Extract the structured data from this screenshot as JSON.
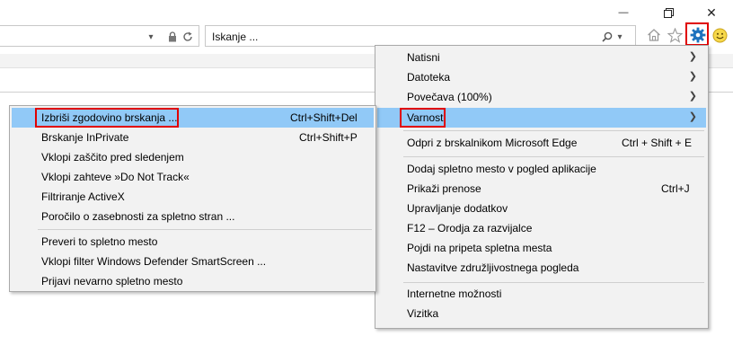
{
  "window": {
    "minimize_label": "—",
    "restore_icon": "restore-icon",
    "close_label": "✕"
  },
  "address": {
    "dropdown_glyph": "▾",
    "lock_icon": "lock-icon",
    "refresh_icon": "refresh-icon"
  },
  "search": {
    "placeholder": "Iskanje ...",
    "search_icon": "search-icon",
    "dropdown_glyph": "▾"
  },
  "toolbar": {
    "home_icon": "home-icon",
    "favorites_icon": "star-icon",
    "tools_icon": "gear-icon",
    "feedback_icon": "smiley-icon"
  },
  "colors": {
    "highlight": "#91c9f7",
    "callout": "#e00000",
    "menu_bg": "#f2f2f2",
    "gear": "#1e73be"
  },
  "tools_menu": {
    "items": [
      {
        "label": "Natisni",
        "shortcut": "",
        "submenu": true
      },
      {
        "label": "Datoteka",
        "shortcut": "",
        "submenu": true
      },
      {
        "label": "Povečava (100%)",
        "shortcut": "",
        "submenu": true
      },
      {
        "label": "Varnost",
        "shortcut": "",
        "submenu": true,
        "highlighted": true
      },
      {
        "label": "Odpri z brskalnikom Microsoft Edge",
        "shortcut": "Ctrl + Shift + E"
      },
      {
        "label": "Dodaj spletno mesto v pogled aplikacije",
        "shortcut": ""
      },
      {
        "label": "Prikaži prenose",
        "shortcut": "Ctrl+J"
      },
      {
        "label": "Upravljanje dodatkov",
        "shortcut": ""
      },
      {
        "label": "F12 – Orodja za razvijalce",
        "shortcut": ""
      },
      {
        "label": "Pojdi na pripeta spletna mesta",
        "shortcut": ""
      },
      {
        "label": "Nastavitve združljivostnega pogleda",
        "shortcut": ""
      },
      {
        "label": "Internetne možnosti",
        "shortcut": ""
      },
      {
        "label": "Vizitka",
        "shortcut": ""
      }
    ]
  },
  "safety_menu": {
    "items": [
      {
        "label": "Izbriši zgodovino brskanja ...",
        "shortcut": "Ctrl+Shift+Del",
        "highlighted": true
      },
      {
        "label": "Brskanje InPrivate",
        "shortcut": "Ctrl+Shift+P"
      },
      {
        "label": "Vklopi zaščito pred sledenjem",
        "shortcut": ""
      },
      {
        "label": "Vklopi zahteve »Do Not Track«",
        "shortcut": ""
      },
      {
        "label": "Filtriranje ActiveX",
        "shortcut": ""
      },
      {
        "label": "Poročilo o zasebnosti za spletno stran ...",
        "shortcut": ""
      },
      {
        "label": "Preveri to spletno mesto",
        "shortcut": ""
      },
      {
        "label": "Vklopi filter Windows Defender SmartScreen ...",
        "shortcut": ""
      },
      {
        "label": "Prijavi nevarno spletno mesto",
        "shortcut": ""
      }
    ]
  }
}
